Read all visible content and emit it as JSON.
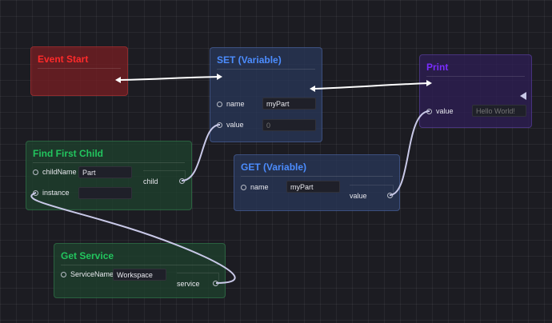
{
  "nodes": {
    "event_start": {
      "title": "Event Start"
    },
    "set_variable": {
      "title": "SET (Variable)",
      "name_label": "name",
      "name_value": "myPart",
      "value_label": "value",
      "value_placeholder": "0"
    },
    "print": {
      "title": "Print",
      "value_label": "value",
      "value_placeholder": "Hello World!"
    },
    "find_first_child": {
      "title": "Find First Child",
      "childname_label": "childName",
      "childname_value": "Part",
      "instance_label": "instance",
      "child_label": "child"
    },
    "get_variable": {
      "title": "GET (Variable)",
      "name_label": "name",
      "name_value": "myPart",
      "value_label": "value"
    },
    "get_service": {
      "title": "Get Service",
      "servicename_label": "ServiceName",
      "servicename_value": "Workspace",
      "service_label": "service"
    }
  },
  "colors": {
    "event_title": "#ff2a2a",
    "variable_title": "#4c8dff",
    "print_title": "#7a2dff",
    "function_title": "#22c55e",
    "exec_wire": "#ffffff",
    "data_wire": "#c9c9e8"
  }
}
